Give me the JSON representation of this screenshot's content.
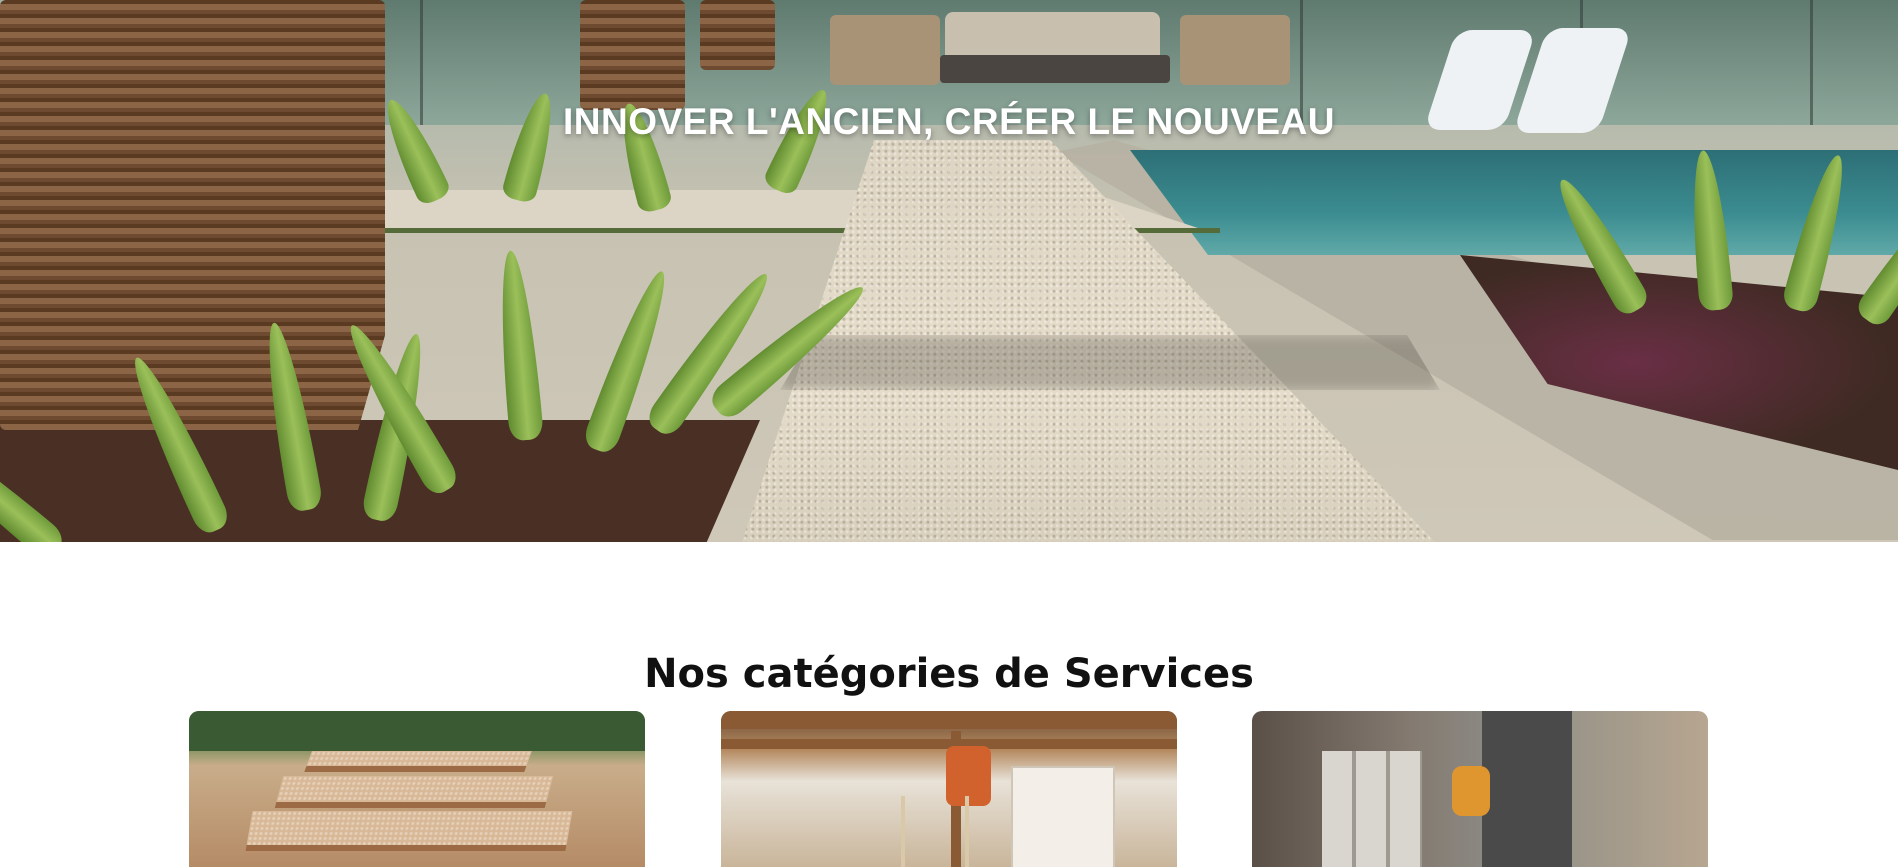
{
  "hero": {
    "title": "INNOVER L'ANCIEN, CRÉER LE NOUVEAU"
  },
  "services": {
    "heading": "Nos catégories de Services",
    "cards": [
      {
        "image": "resin-stone-garden-steps"
      },
      {
        "image": "interior-renovation-worker"
      },
      {
        "image": "masonry-block-wall-worker"
      }
    ]
  }
}
